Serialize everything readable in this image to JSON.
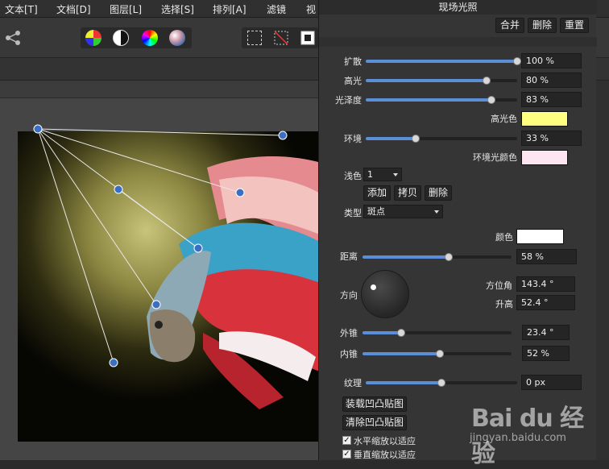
{
  "menu": [
    "文本[T]",
    "文档[D]",
    "图层[L]",
    "选择[S]",
    "排列[A]",
    "滤镜",
    "视"
  ],
  "toolbar": {
    "share_icon": "share-icon",
    "adjust_icons": [
      "color-balance-icon",
      "contrast-icon",
      "color-wheel-icon",
      "gradient-icon"
    ],
    "selection_icons": [
      "marquee-icon",
      "no-selection-icon",
      "invert-selection-icon"
    ]
  },
  "panel": {
    "title": "现场光照",
    "buttons": [
      "合并",
      "删除",
      "重置"
    ],
    "expand": {
      "label": "扩散",
      "value": "100 %",
      "fraction": 1.0
    },
    "highlight": {
      "label": "高光",
      "value": "80 %",
      "fraction": 0.8
    },
    "gloss": {
      "label": "光泽度",
      "value": "83 %",
      "fraction": 0.83
    },
    "highlight_color": {
      "label": "高光色",
      "color": "#ffff80"
    },
    "ambient": {
      "label": "环境",
      "value": "33 %",
      "fraction": 0.33
    },
    "ambient_color": {
      "label": "环境光颜色",
      "color": "#fde6f2"
    },
    "light": {
      "label": "浅色",
      "selected": "1"
    },
    "light_buttons": [
      "添加",
      "拷贝",
      "删除"
    ],
    "type": {
      "label": "类型",
      "selected": "斑点"
    },
    "color": {
      "label": "颜色",
      "color": "#ffffff"
    },
    "distance": {
      "label": "距离",
      "value": "58 %",
      "fraction": 0.58
    },
    "direction": {
      "label": "方向"
    },
    "azimuth": {
      "label": "方位角",
      "value": "143.4 °"
    },
    "elevation": {
      "label": "升高",
      "value": "52.4 °"
    },
    "outer_cone": {
      "label": "外锥",
      "value": "23.4 °",
      "fraction": 0.26
    },
    "inner_cone": {
      "label": "内锥",
      "value": "52 %",
      "fraction": 0.52
    },
    "texture": {
      "label": "纹理",
      "value": "0 px",
      "fraction": 0.5
    },
    "load_bump": "装载凹凸贴图",
    "clear_bump": "清除凹凸贴图",
    "scale_h": "水平缩放以适应",
    "scale_v": "垂直缩放以适应"
  },
  "watermark": {
    "logo": "Bai du 经验",
    "url": "jingyan.baidu.com"
  },
  "colors": {
    "accent": "#5b8ed8",
    "panel_bg": "#353535",
    "node": "#3a6fc4"
  }
}
